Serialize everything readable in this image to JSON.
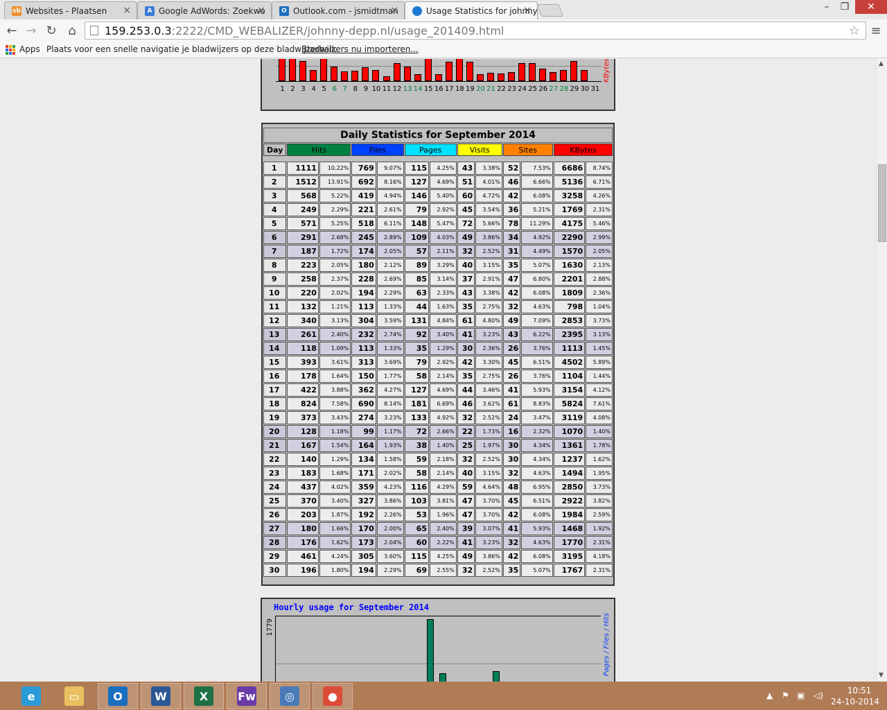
{
  "tabs": [
    {
      "label": "Websites - Plaatsen",
      "icon": "site-favicon",
      "color": "#e8912d"
    },
    {
      "label": "Google AdWords: Zoekwo",
      "icon": "adwords-favicon",
      "color": "#3b7bd8"
    },
    {
      "label": "Outlook.com - jsmidtman",
      "icon": "outlook-favicon",
      "color": "#1a6ec0"
    },
    {
      "label": "Usage Statistics for johnny",
      "icon": "globe-favicon",
      "color": "#1e78d2"
    }
  ],
  "address": {
    "host": "159.253.0.3",
    "path": ":2222/CMD_WEBALIZER/johnny-depp.nl/usage_201409.html"
  },
  "bookmarks": {
    "apps": "Apps",
    "hint": "Plaats voor een snelle navigatie je bladwijzers op deze bladwijzerbalk.",
    "import": "Bladwijzers nu importeren..."
  },
  "daily_graph": {
    "axis_label": "KBytes",
    "day_labels": [
      "1",
      "2",
      "3",
      "4",
      "5",
      "6",
      "7",
      "8",
      "9",
      "10",
      "11",
      "12",
      "13",
      "14",
      "15",
      "16",
      "17",
      "18",
      "19",
      "20",
      "21",
      "22",
      "23",
      "24",
      "25",
      "26",
      "27",
      "28",
      "29",
      "30",
      "31"
    ],
    "weekend_days": [
      6,
      7,
      13,
      14,
      20,
      21,
      27,
      28
    ]
  },
  "table": {
    "caption": "Daily Statistics for September 2014",
    "headers": [
      "Day",
      "Hits",
      "Files",
      "Pages",
      "Visits",
      "Sites",
      "KBytes"
    ],
    "header_colors": [
      "#c0c0c0",
      "#008040",
      "#0040ff",
      "#00e0ff",
      "#ffff00",
      "#ff8000",
      "#ff0000"
    ],
    "rows": [
      [
        "1",
        "1111",
        "10.22%",
        "769",
        "9.07%",
        "115",
        "4.25%",
        "43",
        "3.38%",
        "52",
        "7.53%",
        "6686",
        "8.74%"
      ],
      [
        "2",
        "1512",
        "13.91%",
        "692",
        "8.16%",
        "127",
        "4.69%",
        "51",
        "4.01%",
        "46",
        "6.66%",
        "5136",
        "6.71%"
      ],
      [
        "3",
        "568",
        "5.22%",
        "419",
        "4.94%",
        "146",
        "5.40%",
        "60",
        "4.72%",
        "42",
        "6.08%",
        "3258",
        "4.26%"
      ],
      [
        "4",
        "249",
        "2.29%",
        "221",
        "2.61%",
        "79",
        "2.92%",
        "45",
        "3.54%",
        "36",
        "5.21%",
        "1769",
        "2.31%"
      ],
      [
        "5",
        "571",
        "5.25%",
        "518",
        "6.11%",
        "148",
        "5.47%",
        "72",
        "5.66%",
        "78",
        "11.29%",
        "4175",
        "5.46%"
      ],
      [
        "6",
        "291",
        "2.68%",
        "245",
        "2.89%",
        "109",
        "4.03%",
        "49",
        "3.86%",
        "34",
        "4.92%",
        "2290",
        "2.99%"
      ],
      [
        "7",
        "187",
        "1.72%",
        "174",
        "2.05%",
        "57",
        "2.11%",
        "32",
        "2.52%",
        "31",
        "4.49%",
        "1570",
        "2.05%"
      ],
      [
        "8",
        "223",
        "2.05%",
        "180",
        "2.12%",
        "89",
        "3.29%",
        "40",
        "3.15%",
        "35",
        "5.07%",
        "1630",
        "2.13%"
      ],
      [
        "9",
        "258",
        "2.37%",
        "228",
        "2.69%",
        "85",
        "3.14%",
        "37",
        "2.91%",
        "47",
        "6.80%",
        "2201",
        "2.88%"
      ],
      [
        "10",
        "220",
        "2.02%",
        "194",
        "2.29%",
        "63",
        "2.33%",
        "43",
        "3.38%",
        "42",
        "6.08%",
        "1809",
        "2.36%"
      ],
      [
        "11",
        "132",
        "1.21%",
        "113",
        "1.33%",
        "44",
        "1.63%",
        "35",
        "2.75%",
        "32",
        "4.63%",
        "798",
        "1.04%"
      ],
      [
        "12",
        "340",
        "3.13%",
        "304",
        "3.59%",
        "131",
        "4.84%",
        "61",
        "4.80%",
        "49",
        "7.09%",
        "2853",
        "3.73%"
      ],
      [
        "13",
        "261",
        "2.40%",
        "232",
        "2.74%",
        "92",
        "3.40%",
        "41",
        "3.23%",
        "43",
        "6.22%",
        "2395",
        "3.13%"
      ],
      [
        "14",
        "118",
        "1.09%",
        "113",
        "1.33%",
        "35",
        "1.29%",
        "30",
        "2.36%",
        "26",
        "3.76%",
        "1113",
        "1.45%"
      ],
      [
        "15",
        "393",
        "3.61%",
        "313",
        "3.69%",
        "79",
        "2.92%",
        "42",
        "3.30%",
        "45",
        "6.51%",
        "4502",
        "5.89%"
      ],
      [
        "16",
        "178",
        "1.64%",
        "150",
        "1.77%",
        "58",
        "2.14%",
        "35",
        "2.75%",
        "26",
        "3.76%",
        "1104",
        "1.44%"
      ],
      [
        "17",
        "422",
        "3.88%",
        "362",
        "4.27%",
        "127",
        "4.69%",
        "44",
        "3.46%",
        "41",
        "5.93%",
        "3154",
        "4.12%"
      ],
      [
        "18",
        "824",
        "7.58%",
        "690",
        "8.14%",
        "181",
        "6.69%",
        "46",
        "3.62%",
        "61",
        "8.83%",
        "5824",
        "7.61%"
      ],
      [
        "19",
        "373",
        "3.43%",
        "274",
        "3.23%",
        "133",
        "4.92%",
        "32",
        "2.52%",
        "24",
        "3.47%",
        "3119",
        "4.08%"
      ],
      [
        "20",
        "128",
        "1.18%",
        "99",
        "1.17%",
        "72",
        "2.66%",
        "22",
        "1.73%",
        "16",
        "2.32%",
        "1070",
        "1.40%"
      ],
      [
        "21",
        "167",
        "1.54%",
        "164",
        "1.93%",
        "38",
        "1.40%",
        "25",
        "1.97%",
        "30",
        "4.34%",
        "1361",
        "1.78%"
      ],
      [
        "22",
        "140",
        "1.29%",
        "134",
        "1.58%",
        "59",
        "2.18%",
        "32",
        "2.52%",
        "30",
        "4.34%",
        "1237",
        "1.62%"
      ],
      [
        "23",
        "183",
        "1.68%",
        "171",
        "2.02%",
        "58",
        "2.14%",
        "40",
        "3.15%",
        "32",
        "4.63%",
        "1494",
        "1.95%"
      ],
      [
        "24",
        "437",
        "4.02%",
        "359",
        "4.23%",
        "116",
        "4.29%",
        "59",
        "4.64%",
        "48",
        "6.95%",
        "2850",
        "3.73%"
      ],
      [
        "25",
        "370",
        "3.40%",
        "327",
        "3.86%",
        "103",
        "3.81%",
        "47",
        "3.70%",
        "45",
        "6.51%",
        "2922",
        "3.82%"
      ],
      [
        "26",
        "203",
        "1.87%",
        "192",
        "2.26%",
        "53",
        "1.96%",
        "47",
        "3.70%",
        "42",
        "6.08%",
        "1984",
        "2.59%"
      ],
      [
        "27",
        "180",
        "1.66%",
        "170",
        "2.00%",
        "65",
        "2.40%",
        "39",
        "3.07%",
        "41",
        "5.93%",
        "1468",
        "1.92%"
      ],
      [
        "28",
        "176",
        "1.62%",
        "173",
        "2.04%",
        "60",
        "2.22%",
        "41",
        "3.23%",
        "32",
        "4.63%",
        "1770",
        "2.31%"
      ],
      [
        "29",
        "461",
        "4.24%",
        "305",
        "3.60%",
        "115",
        "4.25%",
        "49",
        "3.86%",
        "42",
        "6.08%",
        "3195",
        "4.18%"
      ],
      [
        "30",
        "196",
        "1.80%",
        "194",
        "2.29%",
        "69",
        "2.55%",
        "32",
        "2.52%",
        "35",
        "5.07%",
        "1767",
        "2.31%"
      ]
    ]
  },
  "hourly": {
    "title": "Hourly usage for September 2014",
    "max_label": "1779",
    "legend": "Pages / Files / Hits"
  },
  "taskbar": {
    "apps": [
      {
        "name": "ie",
        "glyph": "e",
        "color": "#2a9ad8"
      },
      {
        "name": "explorer",
        "glyph": "▭",
        "color": "#e8c060"
      },
      {
        "name": "outlook",
        "glyph": "O",
        "color": "#1a6ec0"
      },
      {
        "name": "word",
        "glyph": "W",
        "color": "#2b5797"
      },
      {
        "name": "excel",
        "glyph": "X",
        "color": "#1e7145"
      },
      {
        "name": "fw",
        "glyph": "Fw",
        "color": "#6a3aa8"
      },
      {
        "name": "setup",
        "glyph": "◎",
        "color": "#4a7ab8"
      },
      {
        "name": "chrome",
        "glyph": "●",
        "color": "#dd4b39"
      }
    ],
    "time": "10:51",
    "date": "24-10-2014"
  }
}
